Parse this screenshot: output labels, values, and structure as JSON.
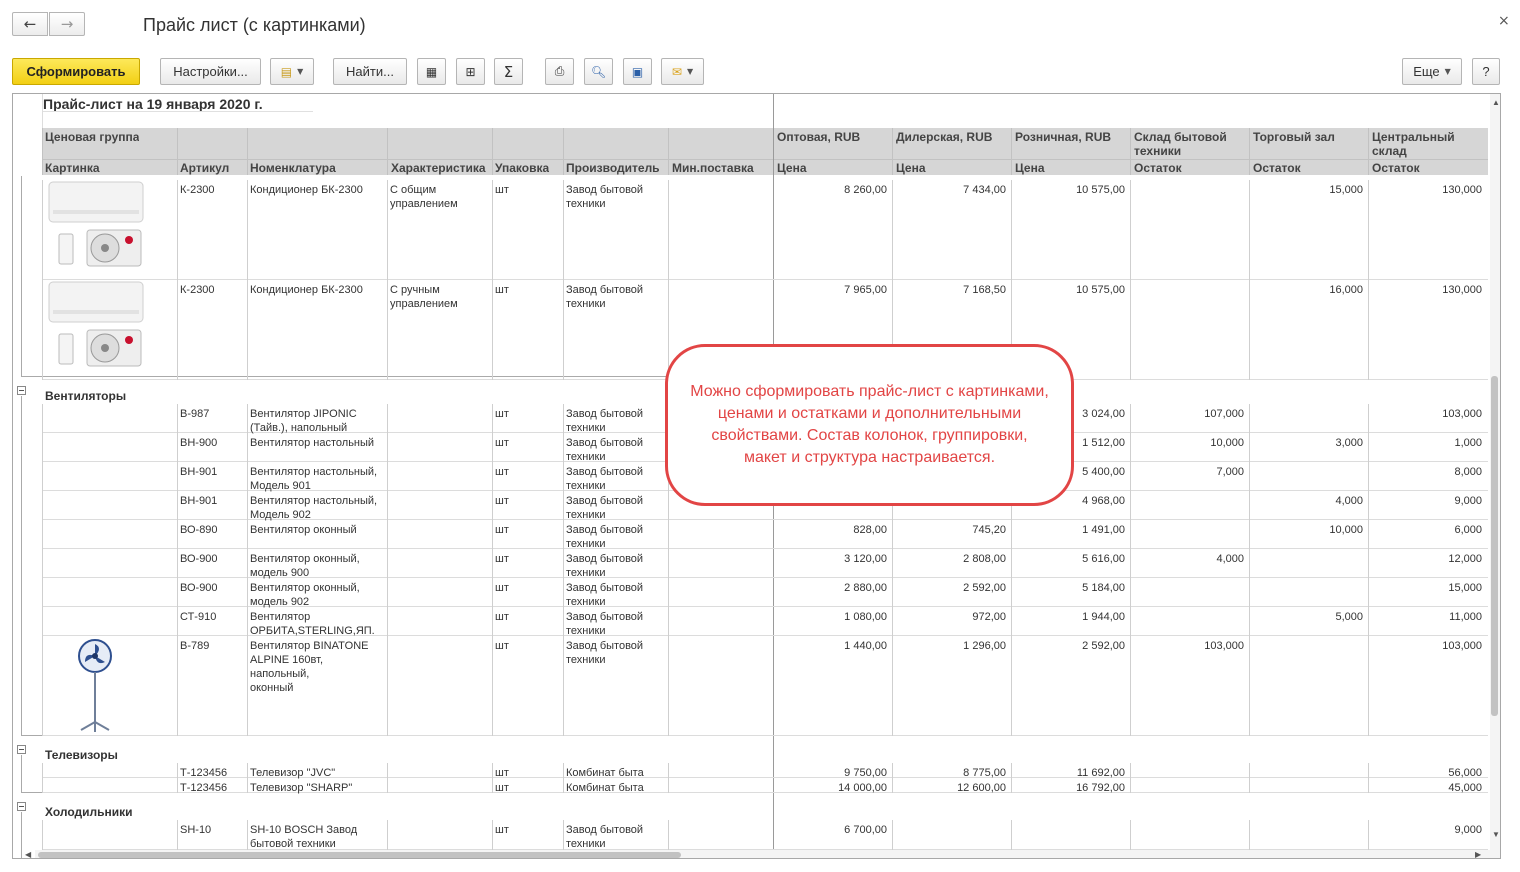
{
  "window": {
    "title": "Прайс лист (с картинками)",
    "close_label": "×",
    "back_label": "←",
    "forward_label": "→"
  },
  "toolbar": {
    "generate": "Сформировать",
    "settings": "Настройки...",
    "find": "Найти...",
    "more": "Еще",
    "help": "?"
  },
  "report": {
    "title": "Прайс-лист на 19 января 2020 г.",
    "header_top": {
      "price_group": "Ценовая группа",
      "wholesale": "Оптовая, RUB",
      "dealer": "Дилерская, RUB",
      "retail": "Розничная, RUB",
      "warehouse": "Склад бытовой техники",
      "trading_hall": "Торговый зал",
      "central": "Центральный склад"
    },
    "header_sub": {
      "picture": "Картинка",
      "article": "Артикул",
      "nomenclature": "Номенклатура",
      "characteristic": "Характеристика",
      "package": "Упаковка",
      "manufacturer": "Производитель",
      "min_supply": "Мин.поставка",
      "price": "Цена",
      "stock": "Остаток"
    },
    "groups": {
      "fans": "Вентиляторы",
      "tvs": "Телевизоры",
      "fridges": "Холодильники"
    },
    "rows": [
      {
        "art": "К-2300",
        "name": "Кондиционер БК-2300",
        "char": "С общим\nуправлением",
        "pack": "шт",
        "mfr": "Завод бытовой\nтехники",
        "opt": "8 260,00",
        "dil": "7 434,00",
        "rozn": "10 575,00",
        "skl": "",
        "zal": "15,000",
        "cen": "130,000"
      },
      {
        "art": "К-2300",
        "name": "Кондиционер БК-2300",
        "char": "С ручным\nуправлением",
        "pack": "шт",
        "mfr": "Завод бытовой\nтехники",
        "opt": "7 965,00",
        "dil": "7 168,50",
        "rozn": "10 575,00",
        "skl": "",
        "zal": "16,000",
        "cen": "130,000"
      },
      {
        "art": "В-987",
        "name": "Вентилятор JIPONIC\n(Тайв.), напольный",
        "char": "",
        "pack": "шт",
        "mfr": "Завод бытовой\nтехники",
        "opt": "",
        "dil": "",
        "rozn": "3 024,00",
        "skl": "107,000",
        "zal": "",
        "cen": "103,000"
      },
      {
        "art": "ВН-900",
        "name": "Вентилятор настольный",
        "char": "",
        "pack": "шт",
        "mfr": "Завод бытовой\nтехники",
        "opt": "",
        "dil": "",
        "rozn": "1 512,00",
        "skl": "10,000",
        "zal": "3,000",
        "cen": "1,000"
      },
      {
        "art": "ВН-901",
        "name": "Вентилятор настольный,\nМодель 901",
        "char": "",
        "pack": "шт",
        "mfr": "Завод бытовой\nтехники",
        "opt": "",
        "dil": "",
        "rozn": "5 400,00",
        "skl": "7,000",
        "zal": "",
        "cen": "8,000"
      },
      {
        "art": "ВН-901",
        "name": "Вентилятор настольный,\nМодель 902",
        "char": "",
        "pack": "шт",
        "mfr": "Завод бытовой\nтехники",
        "opt": "",
        "dil": "",
        "rozn": "4 968,00",
        "skl": "",
        "zal": "4,000",
        "cen": "9,000"
      },
      {
        "art": "ВО-890",
        "name": "Вентилятор оконный",
        "char": "",
        "pack": "шт",
        "mfr": "Завод бытовой\nтехники",
        "opt": "828,00",
        "dil": "745,20",
        "rozn": "1 491,00",
        "skl": "",
        "zal": "10,000",
        "cen": "6,000"
      },
      {
        "art": "ВО-900",
        "name": "Вентилятор оконный,\nмодель 900",
        "char": "",
        "pack": "шт",
        "mfr": "Завод бытовой\nтехники",
        "opt": "3 120,00",
        "dil": "2 808,00",
        "rozn": "5 616,00",
        "skl": "4,000",
        "zal": "",
        "cen": "12,000"
      },
      {
        "art": "ВО-900",
        "name": "Вентилятор оконный,\nмодель 902",
        "char": "",
        "pack": "шт",
        "mfr": "Завод бытовой\nтехники",
        "opt": "2 880,00",
        "dil": "2 592,00",
        "rozn": "5 184,00",
        "skl": "",
        "zal": "",
        "cen": "15,000"
      },
      {
        "art": "СТ-910",
        "name": "Вентилятор\nОРБИТА,STERLING,ЯП.",
        "char": "",
        "pack": "шт",
        "mfr": "Завод бытовой\nтехники",
        "opt": "1 080,00",
        "dil": "972,00",
        "rozn": "1 944,00",
        "skl": "",
        "zal": "5,000",
        "cen": "11,000"
      },
      {
        "art": "В-789",
        "name": "Вентилятор BINATONE\nALPINE 160вт, напольный,\nоконный",
        "char": "",
        "pack": "шт",
        "mfr": "Завод бытовой\nтехники",
        "opt": "1 440,00",
        "dil": "1 296,00",
        "rozn": "2 592,00",
        "skl": "103,000",
        "zal": "",
        "cen": "103,000"
      },
      {
        "art": "Т-123456",
        "name": "Телевизор \"JVC\"",
        "char": "",
        "pack": "шт",
        "mfr": "Комбинат быта",
        "opt": "9 750,00",
        "dil": "8 775,00",
        "rozn": "11 692,00",
        "skl": "",
        "zal": "",
        "cen": "56,000"
      },
      {
        "art": "Т-123456",
        "name": "Телевизор \"SHARP\"",
        "char": "",
        "pack": "шт",
        "mfr": "Комбинат быта",
        "opt": "14 000,00",
        "dil": "12 600,00",
        "rozn": "16 792,00",
        "skl": "",
        "zal": "",
        "cen": "45,000"
      },
      {
        "art": "SH-10",
        "name": "SH-10 BOSCH Завод\nбытовой техники",
        "char": "",
        "pack": "шт",
        "mfr": "Завод бытовой\nтехники",
        "opt": "6 700,00",
        "dil": "",
        "rozn": "",
        "skl": "",
        "zal": "",
        "cen": "9,000"
      }
    ]
  },
  "callout": {
    "text": "Можно сформировать прайс-лист с картинками, ценами и остатками и дополнительными свойствами. Состав колонок, группировки, макет и структура настраивается."
  },
  "icons": [
    "arrow-left-icon",
    "arrow-right-icon",
    "close-icon",
    "variant-icon",
    "group-icon",
    "add-group-icon",
    "sum-icon",
    "print-icon",
    "preview-icon",
    "save-icon",
    "mail-icon",
    "air-conditioner-image",
    "fan-image"
  ],
  "colors": {
    "accent": "#f2cf14",
    "callout": "#e24545",
    "header_bg": "#d6d6d6"
  }
}
